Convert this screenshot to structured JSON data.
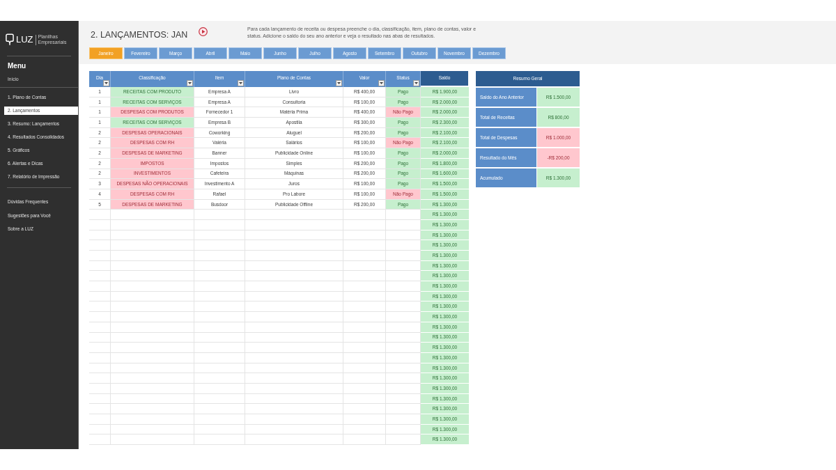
{
  "sidebar": {
    "logo": {
      "text": "LUZ",
      "tagline": "Planilhas Empresariais"
    },
    "menu_title": "Menu",
    "home": "Início",
    "items": [
      {
        "label": "1. Plano de Contas",
        "selected": false
      },
      {
        "label": "2. Lançamentos",
        "selected": true
      },
      {
        "label": "3. Resumo: Lançamentos",
        "selected": false
      },
      {
        "label": "4. Resultados Consolidados",
        "selected": false
      },
      {
        "label": "5. Gráficos",
        "selected": false
      },
      {
        "label": "6. Alertas e Dicas",
        "selected": false
      },
      {
        "label": "7. Relatório de Impressão",
        "selected": false
      }
    ],
    "links": [
      "Dúvidas Frequentes",
      "Sugestões para Você",
      "Sobre a LUZ"
    ]
  },
  "header": {
    "title": "2. LANÇAMENTOS: JAN",
    "description": "Para cada lançamento de receita ou despesa preenche o dia, classificação, item, plano de contas, valor e status. Adicione o saldo do seu ano anterior e veja o resultado nas abas de resultados."
  },
  "month_tabs": [
    {
      "label": "Janeiro",
      "selected": true
    },
    {
      "label": "Fevereiro",
      "selected": false
    },
    {
      "label": "Março",
      "selected": false
    },
    {
      "label": "Abril",
      "selected": false
    },
    {
      "label": "Maio",
      "selected": false
    },
    {
      "label": "Junho",
      "selected": false
    },
    {
      "label": "Julho",
      "selected": false
    },
    {
      "label": "Agosto",
      "selected": false
    },
    {
      "label": "Setembro",
      "selected": false
    },
    {
      "label": "Outubro",
      "selected": false
    },
    {
      "label": "Novembro",
      "selected": false
    },
    {
      "label": "Dezembro",
      "selected": false
    }
  ],
  "table": {
    "columns": [
      {
        "label": "Dia",
        "filter": true
      },
      {
        "label": "Classificação",
        "filter": true
      },
      {
        "label": "Item",
        "filter": true
      },
      {
        "label": "Plano de Contas",
        "filter": true
      },
      {
        "label": "Valor",
        "filter": true
      },
      {
        "label": "Status",
        "filter": true
      },
      {
        "label": "Saldo",
        "filter": false
      }
    ],
    "rows": [
      {
        "kind": "income",
        "day": "1",
        "classification": "RECEITAS COM PRODUTO",
        "item": "Empresa A",
        "account": "Livro",
        "value": "R$ 400,00",
        "status": "Pago",
        "paid": true,
        "balance": "R$ 1.900,00"
      },
      {
        "kind": "income",
        "day": "1",
        "classification": "RECEITAS COM SERVIÇOS",
        "item": "Empresa A",
        "account": "Consultoria",
        "value": "R$ 100,00",
        "status": "Pago",
        "paid": true,
        "balance": "R$ 2.000,00"
      },
      {
        "kind": "expense",
        "day": "1",
        "classification": "DESPESAS COM PRODUTOS",
        "item": "Fornecedor 1",
        "account": "Matéria Prima",
        "value": "R$ 400,00",
        "status": "Não Pago",
        "paid": false,
        "balance": "R$ 2.000,00"
      },
      {
        "kind": "income",
        "day": "1",
        "classification": "RECEITAS COM SERVIÇOS",
        "item": "Empresa B",
        "account": "Apostila",
        "value": "R$ 300,00",
        "status": "Pago",
        "paid": true,
        "balance": "R$ 2.300,00"
      },
      {
        "kind": "expense",
        "day": "2",
        "classification": "DESPESAS OPERACIONAIS",
        "item": "Coworking",
        "account": "Aluguel",
        "value": "R$ 200,00",
        "status": "Pago",
        "paid": true,
        "balance": "R$ 2.100,00"
      },
      {
        "kind": "expense",
        "day": "2",
        "classification": "DESPESAS COM RH",
        "item": "Valéria",
        "account": "Salários",
        "value": "R$ 100,00",
        "status": "Não Pago",
        "paid": false,
        "balance": "R$ 2.100,00"
      },
      {
        "kind": "expense",
        "day": "2",
        "classification": "DESPESAS DE MARKETING",
        "item": "Banner",
        "account": "Publicidade Online",
        "value": "R$ 100,00",
        "status": "Pago",
        "paid": true,
        "balance": "R$ 2.000,00"
      },
      {
        "kind": "expense",
        "day": "2",
        "classification": "IMPOSTOS",
        "item": "Impostos",
        "account": "Simples",
        "value": "R$ 200,00",
        "status": "Pago",
        "paid": true,
        "balance": "R$ 1.800,00"
      },
      {
        "kind": "expense",
        "day": "2",
        "classification": "INVESTIMENTOS",
        "item": "Cafeteira",
        "account": "Máquinas",
        "value": "R$ 200,00",
        "status": "Pago",
        "paid": true,
        "balance": "R$ 1.600,00"
      },
      {
        "kind": "expense",
        "day": "3",
        "classification": "DESPESAS NÃO OPERACIONAIS",
        "item": "Investimento A",
        "account": "Juros",
        "value": "R$ 100,00",
        "status": "Pago",
        "paid": true,
        "balance": "R$ 1.500,00"
      },
      {
        "kind": "expense",
        "day": "4",
        "classification": "DESPESAS COM RH",
        "item": "Rafael",
        "account": "Pro Labore",
        "value": "R$ 100,00",
        "status": "Não Pago",
        "paid": false,
        "balance": "R$ 1.500,00"
      },
      {
        "kind": "expense",
        "day": "5",
        "classification": "DESPESAS DE MARKETING",
        "item": "Busdoor",
        "account": "Publicidade Offline",
        "value": "R$ 200,00",
        "status": "Pago",
        "paid": true,
        "balance": "R$ 1.300,00"
      },
      {
        "balance": "R$ 1.300,00"
      },
      {
        "balance": "R$ 1.300,00"
      },
      {
        "balance": "R$ 1.300,00"
      },
      {
        "balance": "R$ 1.300,00"
      },
      {
        "balance": "R$ 1.300,00"
      },
      {
        "balance": "R$ 1.300,00"
      },
      {
        "balance": "R$ 1.300,00"
      },
      {
        "balance": "R$ 1.300,00"
      },
      {
        "balance": "R$ 1.300,00"
      },
      {
        "balance": "R$ 1.300,00"
      },
      {
        "balance": "R$ 1.300,00"
      },
      {
        "balance": "R$ 1.300,00"
      },
      {
        "balance": "R$ 1.300,00"
      },
      {
        "balance": "R$ 1.300,00"
      },
      {
        "balance": "R$ 1.300,00"
      },
      {
        "balance": "R$ 1.300,00"
      },
      {
        "balance": "R$ 1.300,00"
      },
      {
        "balance": "R$ 1.300,00"
      },
      {
        "balance": "R$ 1.300,00"
      },
      {
        "balance": "R$ 1.300,00"
      },
      {
        "balance": "R$ 1.300,00"
      },
      {
        "balance": "R$ 1.300,00"
      },
      {
        "balance": "R$ 1.300,00"
      }
    ]
  },
  "summary": {
    "title": "Resumo Geral",
    "rows": [
      {
        "label": "Saldo do Ano Anterior",
        "value": "R$ 1.500,00",
        "kind": "positive"
      },
      {
        "label": "Total de Receitas",
        "value": "R$ 800,00",
        "kind": "positive"
      },
      {
        "label": "Total de Despesas",
        "value": "R$ 1.000,00",
        "kind": "negative"
      },
      {
        "label": "Resultado do Mês",
        "value": "-R$ 200,00",
        "kind": "negative"
      },
      {
        "label": "Acumulado",
        "value": "R$ 1.300,00",
        "kind": "positive"
      }
    ]
  }
}
